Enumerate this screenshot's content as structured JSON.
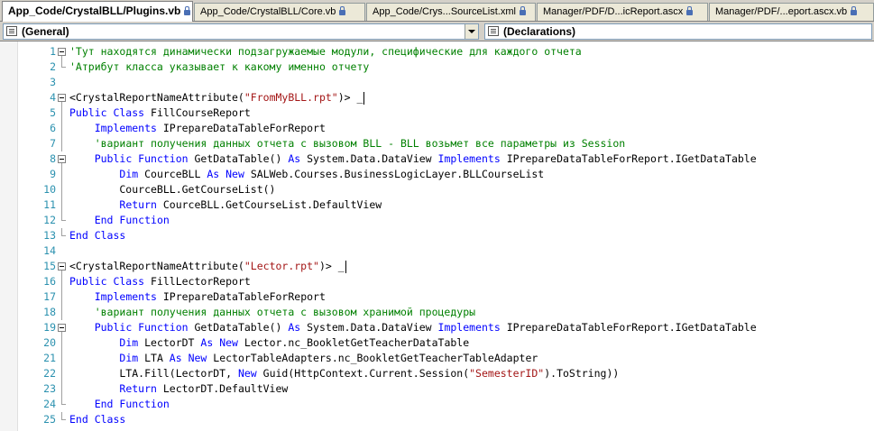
{
  "tabs": [
    {
      "label": "App_Code/CrystalBLL/Plugins.vb",
      "active": true,
      "locked": true
    },
    {
      "label": "App_Code/CrystalBLL/Core.vb",
      "active": false,
      "locked": true
    },
    {
      "label": "App_Code/Crys...SourceList.xml",
      "active": false,
      "locked": true
    },
    {
      "label": "Manager/PDF/D...icReport.ascx",
      "active": false,
      "locked": true
    },
    {
      "label": "Manager/PDF/...eport.ascx.vb",
      "active": false,
      "locked": true
    }
  ],
  "combos": {
    "left": {
      "value": "(General)",
      "icon": "class-icon"
    },
    "right": {
      "value": "(Declarations)",
      "icon": "method-icon"
    }
  },
  "lines": [
    {
      "n": "1",
      "fold": "start",
      "tokens": [
        [
          "cm",
          "'Тут находятся динамически подзагружаемые модули, специфические для каждого отчета"
        ]
      ]
    },
    {
      "n": "2",
      "fold": "end",
      "tokens": [
        [
          "cm",
          "'Атрибут класса указывает к какому именно отчету"
        ]
      ]
    },
    {
      "n": "3",
      "fold": "none",
      "tokens": []
    },
    {
      "n": "4",
      "fold": "start",
      "tokens": [
        [
          "pl",
          "<CrystalReportNameAttribute("
        ],
        [
          "st",
          "\"FromMyBLL.rpt\""
        ],
        [
          "pl",
          ")> _"
        ]
      ]
    },
    {
      "n": "5",
      "fold": "mid",
      "tokens": [
        [
          "kw",
          "Public Class"
        ],
        [
          "pl",
          " FillCourseReport"
        ]
      ]
    },
    {
      "n": "6",
      "fold": "mid",
      "tokens": [
        [
          "pl",
          "    "
        ],
        [
          "kw",
          "Implements"
        ],
        [
          "pl",
          " IPrepareDataTableForReport"
        ]
      ]
    },
    {
      "n": "7",
      "fold": "mid",
      "tokens": [
        [
          "pl",
          "    "
        ],
        [
          "cm",
          "'вариант получения данных отчета с вызовом BLL - BLL возьмет все параметры из Session"
        ]
      ]
    },
    {
      "n": "8",
      "fold": "start",
      "tokens": [
        [
          "pl",
          "    "
        ],
        [
          "kw",
          "Public Function"
        ],
        [
          "pl",
          " GetDataTable() "
        ],
        [
          "kw",
          "As"
        ],
        [
          "pl",
          " System.Data.DataView "
        ],
        [
          "kw",
          "Implements"
        ],
        [
          "pl",
          " IPrepareDataTableForReport.IGetDataTable"
        ]
      ]
    },
    {
      "n": "9",
      "fold": "mid",
      "tokens": [
        [
          "pl",
          "        "
        ],
        [
          "kw",
          "Dim"
        ],
        [
          "pl",
          " CourceBLL "
        ],
        [
          "kw",
          "As New"
        ],
        [
          "pl",
          " SALWeb.Courses.BusinessLogicLayer.BLLCourseList"
        ]
      ]
    },
    {
      "n": "10",
      "fold": "mid",
      "tokens": [
        [
          "pl",
          "        CourceBLL.GetCourseList()"
        ]
      ]
    },
    {
      "n": "11",
      "fold": "mid",
      "tokens": [
        [
          "pl",
          "        "
        ],
        [
          "kw",
          "Return"
        ],
        [
          "pl",
          " CourceBLL.GetCourseList.DefaultView"
        ]
      ]
    },
    {
      "n": "12",
      "fold": "end",
      "tokens": [
        [
          "pl",
          "    "
        ],
        [
          "kw",
          "End Function"
        ]
      ]
    },
    {
      "n": "13",
      "fold": "end",
      "tokens": [
        [
          "kw",
          "End Class"
        ]
      ]
    },
    {
      "n": "14",
      "fold": "none",
      "tokens": []
    },
    {
      "n": "15",
      "fold": "start",
      "tokens": [
        [
          "pl",
          "<CrystalReportNameAttribute("
        ],
        [
          "st",
          "\"Lector.rpt\""
        ],
        [
          "pl",
          ")> _"
        ]
      ]
    },
    {
      "n": "16",
      "fold": "mid",
      "tokens": [
        [
          "kw",
          "Public Class"
        ],
        [
          "pl",
          " FillLectorReport"
        ]
      ]
    },
    {
      "n": "17",
      "fold": "mid",
      "tokens": [
        [
          "pl",
          "    "
        ],
        [
          "kw",
          "Implements"
        ],
        [
          "pl",
          " IPrepareDataTableForReport"
        ]
      ]
    },
    {
      "n": "18",
      "fold": "mid",
      "tokens": [
        [
          "pl",
          "    "
        ],
        [
          "cm",
          "'вариант получения данных отчета с вызовом хранимой процедуры"
        ]
      ]
    },
    {
      "n": "19",
      "fold": "start",
      "tokens": [
        [
          "pl",
          "    "
        ],
        [
          "kw",
          "Public Function"
        ],
        [
          "pl",
          " GetDataTable() "
        ],
        [
          "kw",
          "As"
        ],
        [
          "pl",
          " System.Data.DataView "
        ],
        [
          "kw",
          "Implements"
        ],
        [
          "pl",
          " IPrepareDataTableForReport.IGetDataTable"
        ]
      ]
    },
    {
      "n": "20",
      "fold": "mid",
      "tokens": [
        [
          "pl",
          "        "
        ],
        [
          "kw",
          "Dim"
        ],
        [
          "pl",
          " LectorDT "
        ],
        [
          "kw",
          "As New"
        ],
        [
          "pl",
          " Lector.nc_BookletGetTeacherDataTable"
        ]
      ]
    },
    {
      "n": "21",
      "fold": "mid",
      "tokens": [
        [
          "pl",
          "        "
        ],
        [
          "kw",
          "Dim"
        ],
        [
          "pl",
          " LTA "
        ],
        [
          "kw",
          "As New"
        ],
        [
          "pl",
          " LectorTableAdapters.nc_BookletGetTeacherTableAdapter"
        ]
      ]
    },
    {
      "n": "22",
      "fold": "mid",
      "tokens": [
        [
          "pl",
          "        LTA.Fill(LectorDT, "
        ],
        [
          "kw",
          "New"
        ],
        [
          "pl",
          " Guid(HttpContext.Current.Session("
        ],
        [
          "st",
          "\"SemesterID\""
        ],
        [
          "pl",
          ").ToString))"
        ]
      ]
    },
    {
      "n": "23",
      "fold": "mid",
      "tokens": [
        [
          "pl",
          "        "
        ],
        [
          "kw",
          "Return"
        ],
        [
          "pl",
          " LectorDT.DefaultView"
        ]
      ]
    },
    {
      "n": "24",
      "fold": "end",
      "tokens": [
        [
          "pl",
          "    "
        ],
        [
          "kw",
          "End Function"
        ]
      ]
    },
    {
      "n": "25",
      "fold": "end",
      "tokens": [
        [
          "kw",
          "End Class"
        ]
      ]
    }
  ],
  "colors": {
    "keyword": "#0000ff",
    "comment": "#008000",
    "string": "#a31515",
    "line_number": "#2b91af"
  }
}
